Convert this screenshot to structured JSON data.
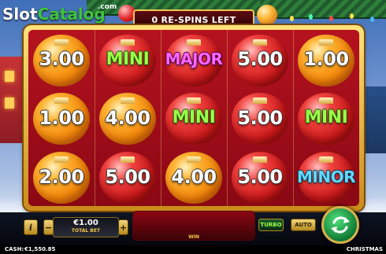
{
  "logo": {
    "text_a": "Slot",
    "text_b": "Catalog",
    "suffix": ".com"
  },
  "banner": {
    "respins_text": "0 RE-SPINS LEFT"
  },
  "grid": {
    "rows": [
      [
        {
          "label": "3.00",
          "kind": "cash",
          "ball": "orange"
        },
        {
          "label": "MINI",
          "kind": "mini",
          "ball": "red"
        },
        {
          "label": "MAJOR",
          "kind": "major",
          "ball": "red"
        },
        {
          "label": "5.00",
          "kind": "cash",
          "ball": "red"
        },
        {
          "label": "1.00",
          "kind": "cash",
          "ball": "orange"
        }
      ],
      [
        {
          "label": "1.00",
          "kind": "cash",
          "ball": "orange"
        },
        {
          "label": "4.00",
          "kind": "cash",
          "ball": "orange"
        },
        {
          "label": "MINI",
          "kind": "mini",
          "ball": "red"
        },
        {
          "label": "5.00",
          "kind": "cash",
          "ball": "red"
        },
        {
          "label": "MINI",
          "kind": "mini",
          "ball": "red"
        }
      ],
      [
        {
          "label": "2.00",
          "kind": "cash",
          "ball": "orange"
        },
        {
          "label": "5.00",
          "kind": "cash",
          "ball": "red"
        },
        {
          "label": "4.00",
          "kind": "cash",
          "ball": "orange"
        },
        {
          "label": "5.00",
          "kind": "cash",
          "ball": "red"
        },
        {
          "label": "MINOR",
          "kind": "minor",
          "ball": "red"
        }
      ]
    ]
  },
  "controls": {
    "info_label": "i",
    "minus_label": "−",
    "plus_label": "+",
    "bet_value": "€1.00",
    "bet_label": "TOTAL BET",
    "win_label": "WIN",
    "turbo_label": "TURBO",
    "auto_label": "AUTO",
    "spin_icon": "refresh-arrows-icon"
  },
  "status": {
    "cash_label": "CASH:",
    "cash_value": "€1,550.85",
    "game_name": "CHRISTMAS"
  },
  "colors": {
    "reel_bg": "#b5121f",
    "frame_gold": "#f2c64e",
    "mini_text": "#9dff4a",
    "major_text": "#ff66ff",
    "minor_text": "#63d8ff"
  }
}
